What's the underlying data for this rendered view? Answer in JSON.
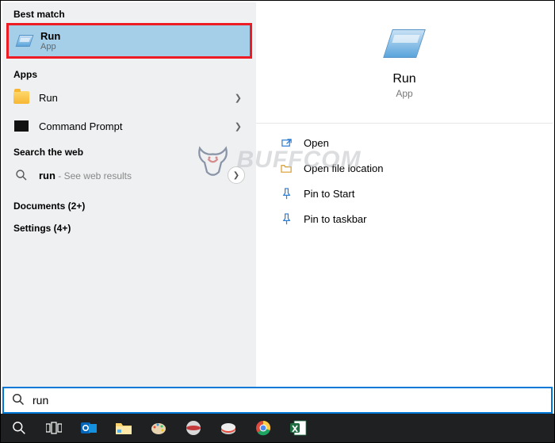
{
  "left": {
    "best_match_header": "Best match",
    "best_match": {
      "title": "Run",
      "subtitle": "App"
    },
    "apps_header": "Apps",
    "apps": [
      {
        "title": "Run"
      },
      {
        "title": "Command Prompt"
      }
    ],
    "search_web_header": "Search the web",
    "web": {
      "query": "run",
      "suffix": " - See web results"
    },
    "documents_header": "Documents (2+)",
    "settings_header": "Settings (4+)"
  },
  "right": {
    "title": "Run",
    "subtitle": "App",
    "actions": [
      {
        "label": "Open"
      },
      {
        "label": "Open file location"
      },
      {
        "label": "Pin to Start"
      },
      {
        "label": "Pin to taskbar"
      }
    ]
  },
  "search": {
    "value": "run"
  },
  "watermark": {
    "text": "BUFFCOM"
  }
}
